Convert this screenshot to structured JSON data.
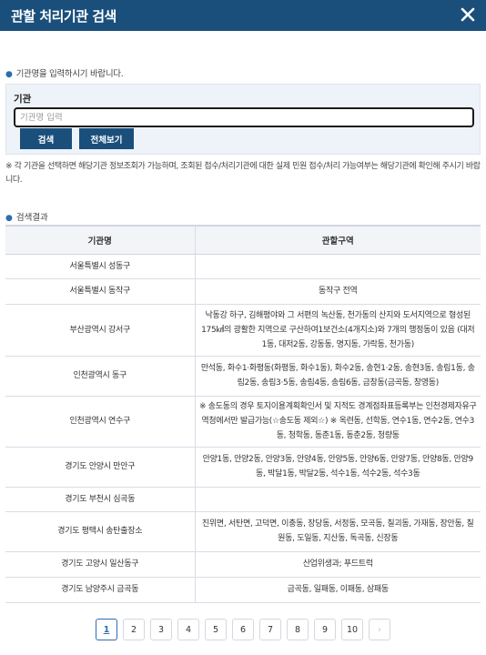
{
  "header": {
    "title": "관할 처리기관 검색",
    "close_icon": "close-icon"
  },
  "guide": {
    "text": "기관명을 입력하시기 바랍니다."
  },
  "search": {
    "label": "기관",
    "placeholder": "기관명 입력",
    "value": "",
    "search_button": "검색",
    "all_button": "전체보기"
  },
  "notice": "※ 각 기관을 선택하면 해당기관 정보조회가 가능하며, 조회된 접수/처리기관에 대한 실제 민원 접수/처리 가능여부는 해당기관에 확인해 주시기 바랍니다.",
  "results": {
    "title": "검색결과",
    "headers": [
      "기관명",
      "관할구역"
    ],
    "rows": [
      {
        "name": "서울특별시 성동구",
        "area": ""
      },
      {
        "name": "서울특별시 동작구",
        "area": "동작구 전역"
      },
      {
        "name": "부산광역시 강서구",
        "area": "낙동강 하구, 김해평야와 그 서편의 녹산동, 천가동의 산지와 도서지역으로 형성된 175㎢의 광활한 지역으로 구산하여1보건소(4개지소)와 7개의 행정동이 있음 (대저1동, 대저2동, 강동동, 명지동, 가락동, 천가동)"
      },
      {
        "name": "인천광역시 동구",
        "area": "만석동, 화수1·화평동(화평동, 화수1동), 화수2동, 송현1·2동, 송현3동, 송림1동, 송림2동, 송림3·5동, 송림4동, 송림6동, 금창동(금곡동, 창영동)"
      },
      {
        "name": "인천광역시 연수구",
        "area": "※ 송도동의 경우 토지이용계획확인서 및 지적도 경계점좌표등록부는 인천경제자유구역청에서만 발급가능(☆송도동 제외☆) ※ 옥련동, 선학동, 연수1동, 연수2동, 연수3동, 청학동, 동춘1동, 동춘2동, 청량동"
      },
      {
        "name": "경기도 안양시 만안구",
        "area": "안양1동, 안양2동, 안양3동, 안양4동, 안양5동, 안양6동, 안양7동, 안양8동, 안양9동, 박달1동, 박달2동, 석수1동, 석수2동, 석수3동"
      },
      {
        "name": "경기도 부천시 심곡동",
        "area": ""
      },
      {
        "name": "경기도 평택시 송탄출장소",
        "area": "진위면, 서탄면, 고덕면, 이충동, 장당동, 서정동, 모곡동, 칠괴동, 가재동, 장안동, 칠원동, 도일동, 지산동, 독곡동, 신장동"
      },
      {
        "name": "경기도 고양시 일산동구",
        "area": "산업위생과; 푸드트럭"
      },
      {
        "name": "경기도 남양주시 금곡동",
        "area": "금곡동, 일패동, 이패동, 삼패동"
      }
    ]
  },
  "pagination": {
    "pages": [
      "1",
      "2",
      "3",
      "4",
      "5",
      "6",
      "7",
      "8",
      "9",
      "10"
    ],
    "current": "1",
    "next_label": "›"
  }
}
